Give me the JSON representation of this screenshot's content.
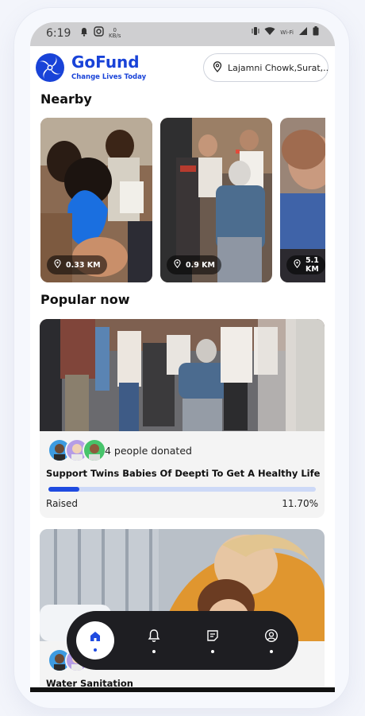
{
  "status_bar": {
    "time": "6:19",
    "speed_value": "0",
    "speed_unit": "KB/s",
    "wifi_label": "Wi-Fi"
  },
  "brand": {
    "name": "GoFund",
    "tagline": "Change Lives Today",
    "color": "#1943d8"
  },
  "location": {
    "icon": "location-pin-icon",
    "text": "Lajamni Chowk,Surat,..."
  },
  "sections": {
    "nearby": "Nearby",
    "popular": "Popular now"
  },
  "nearby": [
    {
      "distance": "0.33 KM"
    },
    {
      "distance": "0.9 KM"
    },
    {
      "distance": "5.1 KM"
    }
  ],
  "popular": [
    {
      "donors_text": "4 people donated",
      "title": "Support Twins Babies Of Deepti To Get A Healthy Life",
      "raised_label": "Raised",
      "raised_percent": "11.70%",
      "progress_fraction": 0.117
    },
    {
      "title": "Water Sanitation"
    }
  ],
  "nav": [
    {
      "icon": "home-icon",
      "active": true
    },
    {
      "icon": "bell-icon"
    },
    {
      "icon": "note-icon"
    },
    {
      "icon": "profile-icon"
    }
  ],
  "colors": {
    "accent": "#1f4be0",
    "progress_track": "#cdd9f7",
    "nav_bg": "#1e1e22"
  }
}
